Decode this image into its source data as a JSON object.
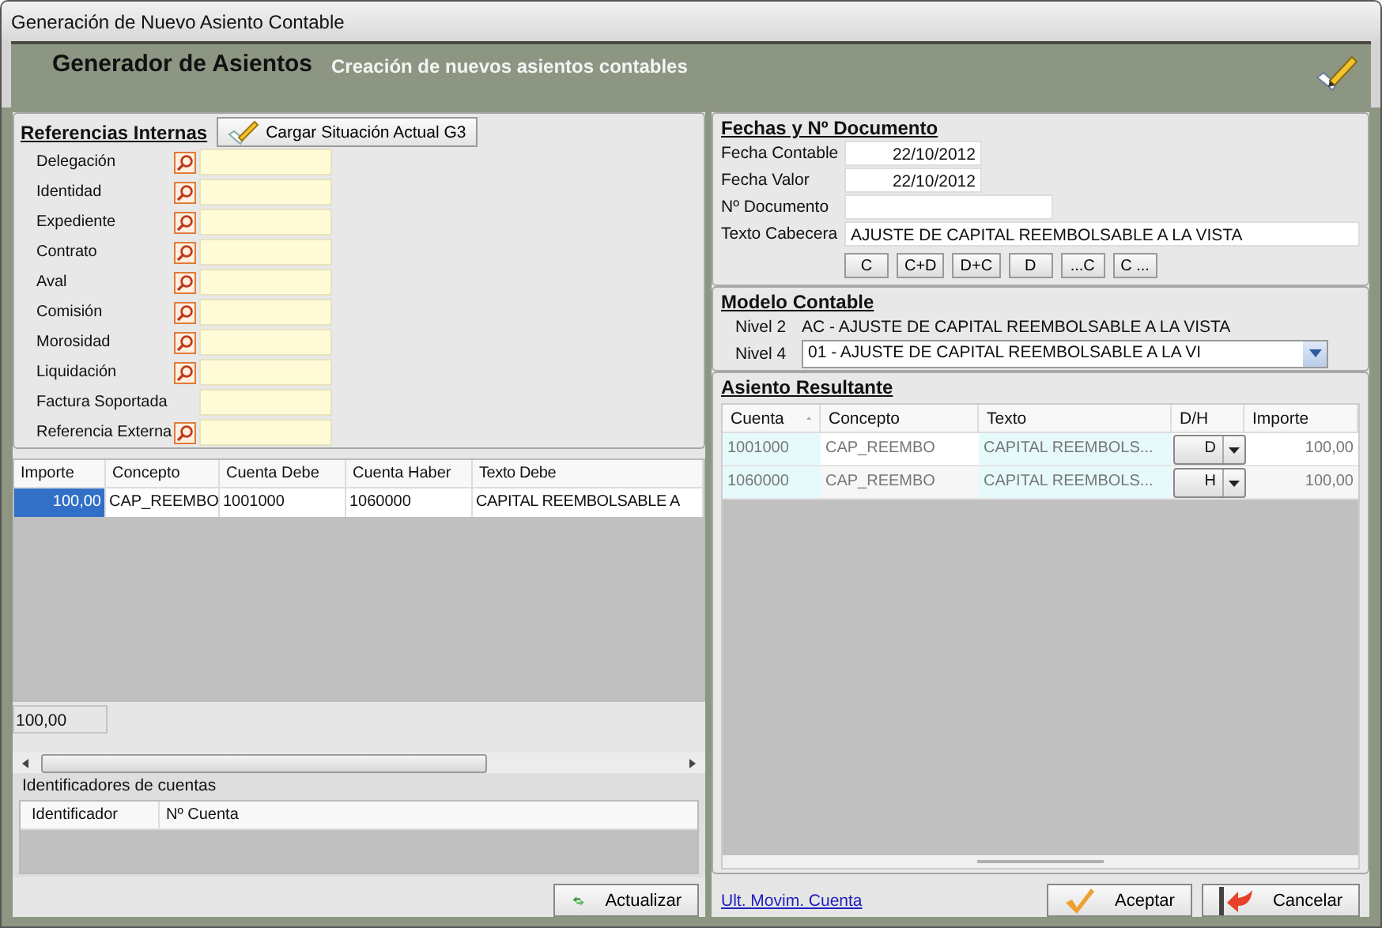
{
  "window": {
    "title": "Generación de Nuevo Asiento Contable"
  },
  "header": {
    "title": "Generador de Asientos",
    "subtitle": "Creación de nuevos asientos contables"
  },
  "referencias": {
    "title": "Referencias Internas",
    "load_button": "Cargar Situación Actual G3",
    "fields": [
      {
        "label": "Delegación",
        "lookup": true
      },
      {
        "label": "Identidad",
        "lookup": true
      },
      {
        "label": "Expediente",
        "lookup": true
      },
      {
        "label": "Contrato",
        "lookup": true
      },
      {
        "label": "Aval",
        "lookup": true
      },
      {
        "label": "Comisión",
        "lookup": true
      },
      {
        "label": "Morosidad",
        "lookup": true
      },
      {
        "label": "Liquidación",
        "lookup": true
      },
      {
        "label": "Factura Soportada",
        "lookup": false
      },
      {
        "label": "Referencia Externa",
        "lookup": true
      }
    ]
  },
  "movimientos": {
    "columns": [
      "Importe",
      "Concepto",
      "Cuenta Debe",
      "Cuenta Haber",
      "Texto Debe"
    ],
    "rows": [
      {
        "cells": [
          "100,00",
          "CAP_REEMBO",
          "1001000",
          "1060000",
          "CAPITAL REEMBOLSABLE A"
        ],
        "selected": true
      }
    ],
    "total": "100,00"
  },
  "identificadores": {
    "title": "Identificadores de cuentas",
    "columns": [
      "Identificador",
      "Nº Cuenta"
    ]
  },
  "actualizar_button": "Actualizar",
  "fechas": {
    "title": "Fechas y Nº Documento",
    "fields": [
      {
        "label": "Fecha Contable",
        "value": "22/10/2012",
        "kind": "date"
      },
      {
        "label": "Fecha Valor",
        "value": "22/10/2012",
        "kind": "date"
      },
      {
        "label": "Nº Documento",
        "kind": "text"
      },
      {
        "label": "Texto Cabecera",
        "value": "AJUSTE DE CAPITAL REEMBOLSABLE A LA VISTA",
        "kind": "wide"
      }
    ],
    "buttons": [
      "C",
      "C+D",
      "D+C",
      "D",
      "...C",
      "C ..."
    ]
  },
  "modelo": {
    "title": "Modelo Contable",
    "nivel2": {
      "label": "Nivel 2",
      "value": "AC - AJUSTE DE CAPITAL REEMBOLSABLE A LA VISTA"
    },
    "nivel4": {
      "label": "Nivel 4",
      "value": "01 - AJUSTE DE CAPITAL REEMBOLSABLE A LA VI"
    }
  },
  "asiento": {
    "title": "Asiento Resultante",
    "columns": [
      {
        "label": "Cuenta",
        "sorted": true
      },
      {
        "label": "Concepto",
        "sorted": false
      },
      {
        "label": "Texto",
        "sorted": false
      },
      {
        "label": "D/H",
        "sorted": false
      },
      {
        "label": "Importe",
        "sorted": false
      }
    ],
    "rows": [
      {
        "cuenta": "1001000",
        "concepto": "CAP_REEMBO",
        "texto": "CAPITAL REEMBOLS...",
        "dh": "D",
        "importe": "100,00"
      },
      {
        "cuenta": "1060000",
        "concepto": "CAP_REEMBO",
        "texto": "CAPITAL REEMBOLS...",
        "dh": "H",
        "importe": "100,00"
      }
    ]
  },
  "footer": {
    "link": "Ult. Movim. Cuenta",
    "accept": "Aceptar",
    "cancel": "Cancelar"
  }
}
